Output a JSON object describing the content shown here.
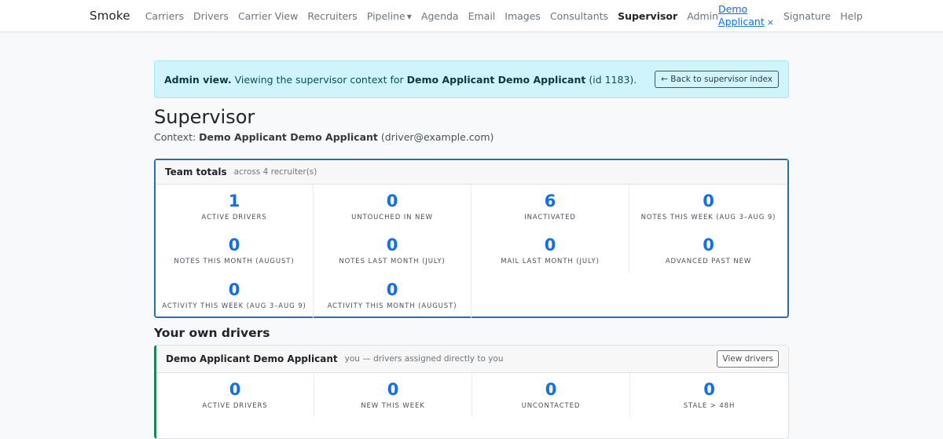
{
  "nav": {
    "brand": "Smoke",
    "links": [
      "Carriers",
      "Drivers",
      "Carrier View",
      "Recruiters",
      "Pipeline",
      "Agenda",
      "Email",
      "Images",
      "Consultants",
      "Supervisor",
      "Admin"
    ],
    "user": "Demo Applicant",
    "close_glyph": "×",
    "right_links": [
      "Signature",
      "Help"
    ]
  },
  "alert": {
    "prefix": "Admin view.",
    "text": "Viewing the supervisor context for",
    "name": "Demo Applicant Demo Applicant",
    "suffix": "(id 1183).",
    "back_label": "← Back to supervisor index"
  },
  "page": {
    "title": "Supervisor",
    "context_label": "Context:",
    "context_name": "Demo Applicant Demo Applicant",
    "context_email": "(driver@example.com)"
  },
  "team": {
    "title": "Team totals",
    "subtitle": "across 4 recruiter(s)",
    "stats": [
      {
        "value": "1",
        "label": "Active drivers"
      },
      {
        "value": "0",
        "label": "Untouched in New"
      },
      {
        "value": "6",
        "label": "Inactivated"
      },
      {
        "value": "0",
        "label": "Notes this week (Aug 3–Aug 9)"
      },
      {
        "value": "0",
        "label": "Notes this month (August)"
      },
      {
        "value": "0",
        "label": "Notes last month (July)"
      },
      {
        "value": "0",
        "label": "Mail last month (July)"
      },
      {
        "value": "0",
        "label": "Advanced past New"
      },
      {
        "value": "0",
        "label": "Activity this week (Aug 3–Aug 9)"
      },
      {
        "value": "0",
        "label": "Activity this month (August)"
      }
    ]
  },
  "own": {
    "section_title": "Your own drivers",
    "name": "Demo Applicant Demo Applicant",
    "subtitle": "you — drivers assigned directly to you",
    "view_label": "View drivers",
    "stats": [
      {
        "value": "0",
        "label": "Active drivers"
      },
      {
        "value": "0",
        "label": "New this week"
      },
      {
        "value": "0",
        "label": "Uncontacted"
      },
      {
        "value": "0",
        "label": "Stale > 48h"
      }
    ]
  }
}
